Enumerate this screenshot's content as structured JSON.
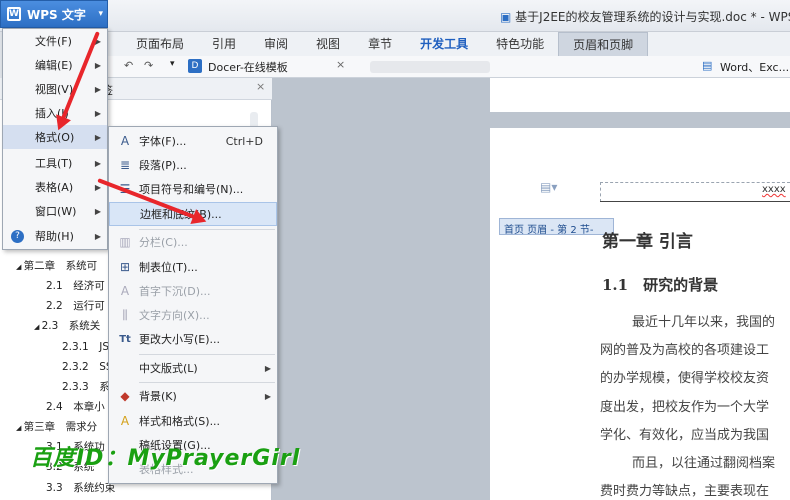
{
  "app": {
    "wps_button": "WPS 文字",
    "doc_title": "基于J2EE的校友管理系统的设计与实现.doc * - WPS"
  },
  "tabs": [
    "页面布局",
    "引用",
    "审阅",
    "视图",
    "章节",
    "开发工具",
    "特色功能",
    "页眉和页脚"
  ],
  "quickbar": {
    "docer": "Docer-在线模板",
    "word_exc": "Word、Exc..."
  },
  "nav": {
    "header": "签",
    "items": [
      "第二章　系统可",
      "2.1　经济可",
      "2.2　运行可",
      "2.3　系统关",
      "2.3.1　JS",
      "2.3.2　SS",
      "2.3.3　系",
      "2.4　本章小",
      "第三章　需求分",
      "3.1　系统功",
      "3.2　系统",
      "3.3　系统约束"
    ]
  },
  "main_menu": {
    "items": [
      {
        "label": "文件(F)",
        "arrow": true
      },
      {
        "label": "编辑(E)",
        "arrow": true
      },
      {
        "label": "视图(V)",
        "arrow": true
      },
      {
        "label": "插入(I)",
        "arrow": true
      },
      {
        "label": "格式(O)",
        "arrow": true,
        "selected": true
      },
      {
        "label": "工具(T)",
        "arrow": true
      },
      {
        "label": "表格(A)",
        "arrow": true
      },
      {
        "label": "窗口(W)",
        "arrow": true
      },
      {
        "label": "帮助(H)",
        "arrow": true
      }
    ]
  },
  "format_menu": {
    "items": [
      {
        "icon": "A",
        "label": "字体(F)...",
        "shortcut": "Ctrl+D"
      },
      {
        "icon": "≣",
        "label": "段落(P)..."
      },
      {
        "icon": "☰",
        "label": "项目符号和编号(N)..."
      },
      {
        "icon": "",
        "label": "边框和底纹(B)...",
        "highlight": true
      },
      {
        "icon": "▥",
        "label": "分栏(C)...",
        "disabled": true
      },
      {
        "icon": "⊞",
        "label": "制表位(T)..."
      },
      {
        "icon": "A",
        "label": "首字下沉(D)...",
        "disabled": true
      },
      {
        "icon": "⫼",
        "label": "文字方向(X)...",
        "disabled": true
      },
      {
        "icon": "Tt",
        "label": "更改大小写(E)..."
      },
      {
        "icon": "",
        "label": "中文版式(L)",
        "arrow": true
      },
      {
        "icon": "◆",
        "label": "背景(K)",
        "arrow": true
      },
      {
        "icon": "A",
        "label": "样式和格式(S)..."
      },
      {
        "icon": "",
        "label": "稿纸设置(G)..."
      },
      {
        "icon": "",
        "label": "表格样式...",
        "disabled": true
      }
    ]
  },
  "document": {
    "header_text": "xxxx",
    "header_tag": "首页 页眉 - 第 2 节-",
    "chapter": "第一章  引言",
    "section": "1.1　研究的背景",
    "lines": [
      "最近十几年以来，我国的",
      "网的普及为高校的各项建设工",
      "的办学规模，使得学校校友资",
      "度出发，把校友作为一个大学",
      "学化、有效化，应当成为我国",
      "而且，以往通过翻阅档案",
      "费时费力等缺点，主要表现在"
    ]
  },
  "watermark": "百度ID：MyPrayerGirl",
  "colors": {
    "accent": "#2d6fc4",
    "arrow": "#e8262b",
    "watermark": "#1aa012"
  }
}
